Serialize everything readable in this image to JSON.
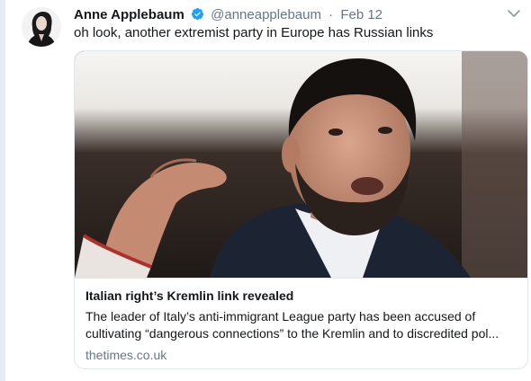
{
  "tweet": {
    "author_name": "Anne Applebaum",
    "handle": "@anneapplebaum",
    "separator": "·",
    "date": "Feb 12",
    "text": "oh look, another extremist party in Europe has Russian links",
    "verified": true,
    "menu_icon": "chevron-down-icon"
  },
  "card": {
    "title": "Italian right’s Kremlin link revealed",
    "description": "The leader of Italy’s anti-immigrant League party has been accused of cultivating “dangerous connections” to the Kremlin and to discredited pol...",
    "domain": "thetimes.co.uk"
  },
  "colors": {
    "text": "#14171a",
    "secondary": "#657786",
    "verified_blue": "#1da1f2",
    "border": "#e1e8ed"
  }
}
